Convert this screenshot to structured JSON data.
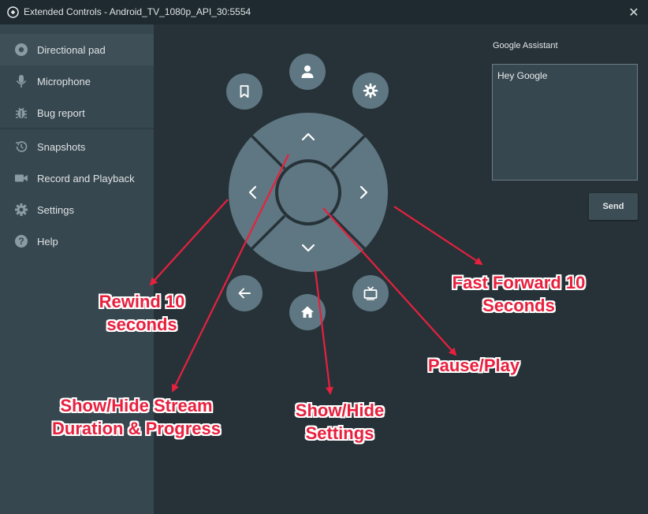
{
  "window": {
    "title": "Extended Controls - Android_TV_1080p_API_30:5554",
    "close_glyph": "✕"
  },
  "sidebar": {
    "items": [
      {
        "label": "Directional pad",
        "icon": "gamepad-icon"
      },
      {
        "label": "Microphone",
        "icon": "microphone-icon"
      },
      {
        "label": "Bug report",
        "icon": "bug-icon"
      },
      {
        "label": "Snapshots",
        "icon": "history-icon"
      },
      {
        "label": "Record and Playback",
        "icon": "videocam-icon"
      },
      {
        "label": "Settings",
        "icon": "gear-icon"
      },
      {
        "label": "Help",
        "icon": "help-icon"
      }
    ]
  },
  "dpad_buttons": [
    "bookmark-icon",
    "account-icon",
    "settings-icon",
    "back-icon",
    "home-icon",
    "tv-icon"
  ],
  "assistant": {
    "label": "Google Assistant",
    "input_value": "Hey Google",
    "send_label": "Send"
  },
  "annotations": {
    "rewind": [
      "Rewind 10",
      "seconds"
    ],
    "fast_forward": [
      "Fast Forward 10",
      "Seconds"
    ],
    "stream": [
      "Show/Hide Stream",
      "Duration & Progress"
    ],
    "settings": [
      "Show/Hide",
      "Settings"
    ],
    "pause_play": "Pause/Play"
  },
  "colors": {
    "accent_red": "#e8203e",
    "button": "#5f7782",
    "sidebar": "#37474f",
    "background": "#263238"
  }
}
